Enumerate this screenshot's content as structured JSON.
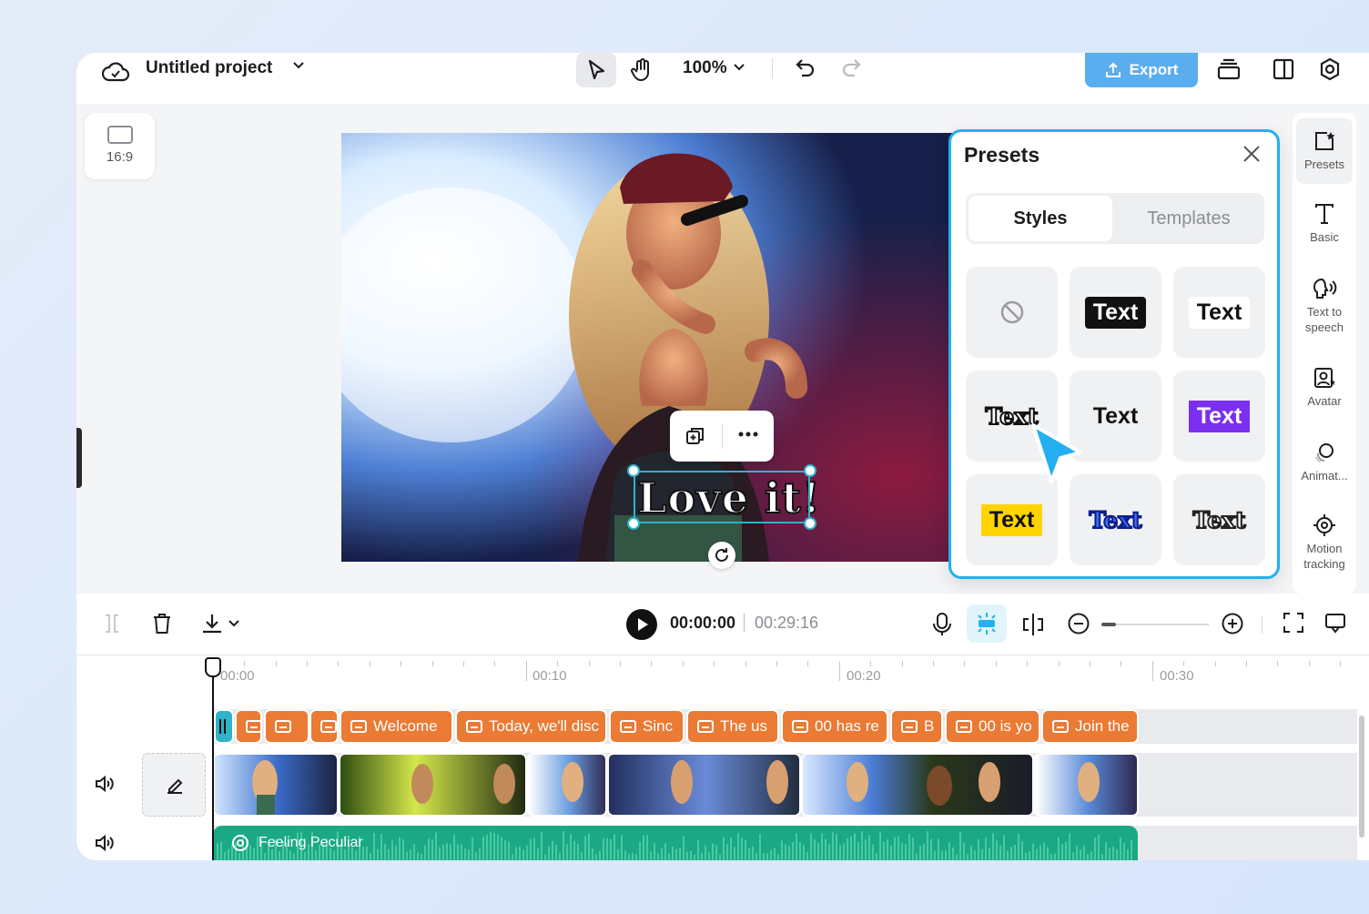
{
  "project": {
    "title": "Untitled project"
  },
  "toolbar": {
    "zoom": "100%",
    "export_label": "Export"
  },
  "aspect_ratio": {
    "label": "16:9"
  },
  "caption": {
    "text": "Love it!"
  },
  "presets_panel": {
    "title": "Presets",
    "tabs": [
      {
        "label": "Styles",
        "active": true
      },
      {
        "label": "Templates",
        "active": false
      }
    ],
    "tiles": [
      {
        "label": "",
        "style": "none"
      },
      {
        "label": "Text",
        "style": "white-on-black"
      },
      {
        "label": "Text",
        "style": "black-on-white"
      },
      {
        "label": "Text",
        "style": "white-outline-black"
      },
      {
        "label": "Text",
        "style": "plain-black"
      },
      {
        "label": "Text",
        "style": "white-on-purple"
      },
      {
        "label": "Text",
        "style": "black-on-yellow"
      },
      {
        "label": "Text",
        "style": "blue-outline"
      },
      {
        "label": "Text",
        "style": "white-outline-dark"
      }
    ]
  },
  "right_sidebar": {
    "items": [
      {
        "label": "Presets",
        "icon": "presets-icon",
        "active": true
      },
      {
        "label": "Basic",
        "icon": "text-icon"
      },
      {
        "label": "Text to speech",
        "icon": "speech-icon"
      },
      {
        "label": "Avatar",
        "icon": "avatar-icon"
      },
      {
        "label": "Animat...",
        "icon": "animation-icon"
      },
      {
        "label": "Motion tracking",
        "icon": "motion-tracking-icon"
      }
    ]
  },
  "player": {
    "current_time": "00:00:00",
    "total_time": "00:29:16"
  },
  "timeline": {
    "ruler": [
      "00:00",
      "00:10",
      "00:20",
      "00:30"
    ],
    "captions": [
      "",
      "",
      "",
      "Welcome",
      "Today, we'll disc",
      "Sinc",
      "The us",
      "00 has re",
      "B",
      "00 is yo",
      "Join the"
    ],
    "audio_label": "Feeling Peculiar"
  },
  "colors": {
    "accent": "#22b0f0",
    "export": "#5aaef0",
    "caption_clip": "#ea7a34",
    "audio_clip": "#1aa984",
    "purple": "#7b2ff0",
    "yellow": "#ffd400"
  }
}
